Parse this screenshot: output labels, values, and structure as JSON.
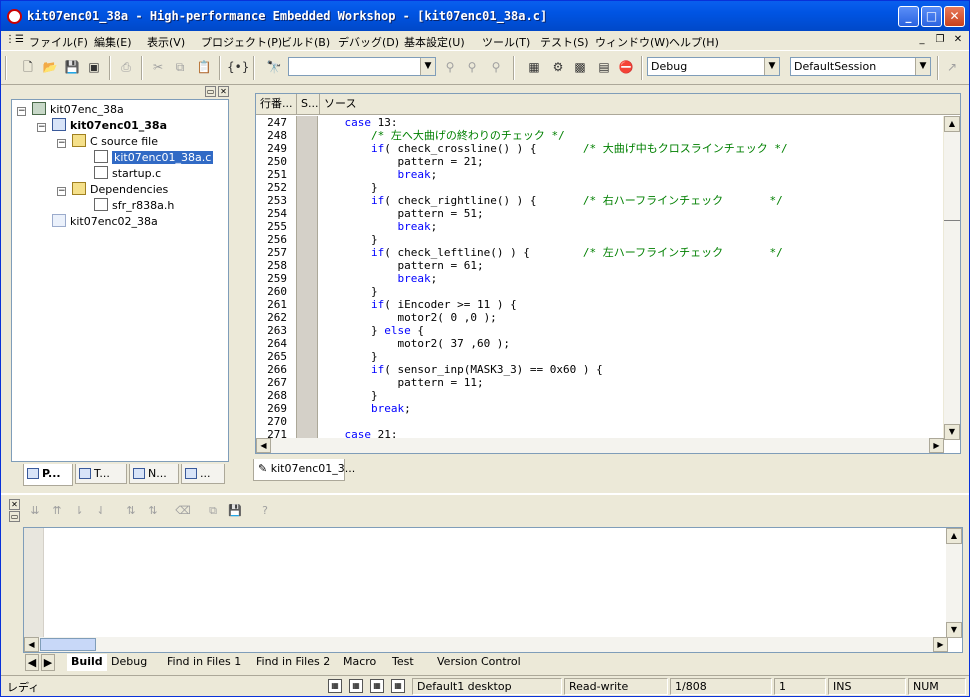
{
  "window": {
    "title": "kit07enc01_38a - High-performance Embedded Workshop - [kit07enc01_38a.c]"
  },
  "menu": [
    "ファイル(F)",
    "編集(E)",
    "表示(V)",
    "プロジェクト(P)",
    "ビルド(B)",
    "デバッグ(D)",
    "基本設定(U)",
    "ツール(T)",
    "テスト(S)",
    "ウィンドウ(W)",
    "ヘルプ(H)"
  ],
  "toolbar": {
    "find_value": "",
    "config_value": "Debug",
    "session_value": "DefaultSession"
  },
  "tree": {
    "workspace": "kit07enc_38a",
    "project": "kit07enc01_38a",
    "folder_source": "C source file",
    "file_main": "kit07enc01_38a.c",
    "file_startup": "startup.c",
    "folder_deps": "Dependencies",
    "file_sfr": "sfr_r838a.h",
    "project2": "kit07enc02_38a"
  },
  "left_tabs": [
    "P...",
    "T...",
    "N...",
    "..."
  ],
  "editor": {
    "col_line": "行番...",
    "col_s": "S...",
    "col_source": "ソース",
    "tab_label": "kit07enc01_3...",
    "lines": [
      {
        "no": "247",
        "segs": [
          {
            "t": "    ",
            "c": ""
          },
          {
            "t": "case",
            "c": "kw"
          },
          {
            "t": " 13:",
            "c": ""
          }
        ]
      },
      {
        "no": "248",
        "segs": [
          {
            "t": "        ",
            "c": ""
          },
          {
            "t": "/* 左へ大曲げの終わりのチェック */",
            "c": "cm"
          }
        ]
      },
      {
        "no": "249",
        "segs": [
          {
            "t": "        ",
            "c": ""
          },
          {
            "t": "if",
            "c": "kw"
          },
          {
            "t": "( check_crossline() ) {       ",
            "c": ""
          },
          {
            "t": "/* 大曲げ中もクロスラインチェック */",
            "c": "cm"
          }
        ]
      },
      {
        "no": "250",
        "segs": [
          {
            "t": "            pattern = 21;",
            "c": ""
          }
        ]
      },
      {
        "no": "251",
        "segs": [
          {
            "t": "            ",
            "c": ""
          },
          {
            "t": "break",
            "c": "kw"
          },
          {
            "t": ";",
            "c": ""
          }
        ]
      },
      {
        "no": "252",
        "segs": [
          {
            "t": "        }",
            "c": ""
          }
        ]
      },
      {
        "no": "253",
        "segs": [
          {
            "t": "        ",
            "c": ""
          },
          {
            "t": "if",
            "c": "kw"
          },
          {
            "t": "( check_rightline() ) {       ",
            "c": ""
          },
          {
            "t": "/* 右ハーフラインチェック       */",
            "c": "cm"
          }
        ]
      },
      {
        "no": "254",
        "segs": [
          {
            "t": "            pattern = 51;",
            "c": ""
          }
        ]
      },
      {
        "no": "255",
        "segs": [
          {
            "t": "            ",
            "c": ""
          },
          {
            "t": "break",
            "c": "kw"
          },
          {
            "t": ";",
            "c": ""
          }
        ]
      },
      {
        "no": "256",
        "segs": [
          {
            "t": "        }",
            "c": ""
          }
        ]
      },
      {
        "no": "257",
        "segs": [
          {
            "t": "        ",
            "c": ""
          },
          {
            "t": "if",
            "c": "kw"
          },
          {
            "t": "( check_leftline() ) {        ",
            "c": ""
          },
          {
            "t": "/* 左ハーフラインチェック       */",
            "c": "cm"
          }
        ]
      },
      {
        "no": "258",
        "segs": [
          {
            "t": "            pattern = 61;",
            "c": ""
          }
        ]
      },
      {
        "no": "259",
        "segs": [
          {
            "t": "            ",
            "c": ""
          },
          {
            "t": "break",
            "c": "kw"
          },
          {
            "t": ";",
            "c": ""
          }
        ]
      },
      {
        "no": "260",
        "segs": [
          {
            "t": "        }",
            "c": ""
          }
        ]
      },
      {
        "no": "261",
        "segs": [
          {
            "t": "        ",
            "c": ""
          },
          {
            "t": "if",
            "c": "kw"
          },
          {
            "t": "( iEncoder >= 11 ) {",
            "c": ""
          }
        ]
      },
      {
        "no": "262",
        "segs": [
          {
            "t": "            motor2( 0 ,0 );",
            "c": ""
          }
        ]
      },
      {
        "no": "263",
        "segs": [
          {
            "t": "        } ",
            "c": ""
          },
          {
            "t": "else",
            "c": "kw"
          },
          {
            "t": " {",
            "c": ""
          }
        ]
      },
      {
        "no": "264",
        "segs": [
          {
            "t": "            motor2( 37 ,60 );",
            "c": ""
          }
        ]
      },
      {
        "no": "265",
        "segs": [
          {
            "t": "        }",
            "c": ""
          }
        ]
      },
      {
        "no": "266",
        "segs": [
          {
            "t": "        ",
            "c": ""
          },
          {
            "t": "if",
            "c": "kw"
          },
          {
            "t": "( sensor_inp(MASK3_3) == 0x60 ) {",
            "c": ""
          }
        ]
      },
      {
        "no": "267",
        "segs": [
          {
            "t": "            pattern = 11;",
            "c": ""
          }
        ]
      },
      {
        "no": "268",
        "segs": [
          {
            "t": "        }",
            "c": ""
          }
        ]
      },
      {
        "no": "269",
        "segs": [
          {
            "t": "        ",
            "c": ""
          },
          {
            "t": "break",
            "c": "kw"
          },
          {
            "t": ";",
            "c": ""
          }
        ]
      },
      {
        "no": "270",
        "segs": [
          {
            "t": "",
            "c": ""
          }
        ]
      },
      {
        "no": "271",
        "segs": [
          {
            "t": "    ",
            "c": ""
          },
          {
            "t": "case",
            "c": "kw"
          },
          {
            "t": " 21:",
            "c": ""
          }
        ]
      }
    ]
  },
  "output_tabs": [
    "Build",
    "Debug",
    "Find in Files 1",
    "Find in Files 2",
    "Macro",
    "Test",
    "Version Control"
  ],
  "status": {
    "left": "レディ",
    "desktop": "Default1 desktop",
    "mode": "Read-write",
    "position": "1/808",
    "col": "1",
    "ins": "INS",
    "num": "NUM"
  },
  "colors": {
    "title_bar": "#0054e3",
    "keyword": "#0000ff",
    "comment": "#008000",
    "selection": "#316ac5"
  }
}
